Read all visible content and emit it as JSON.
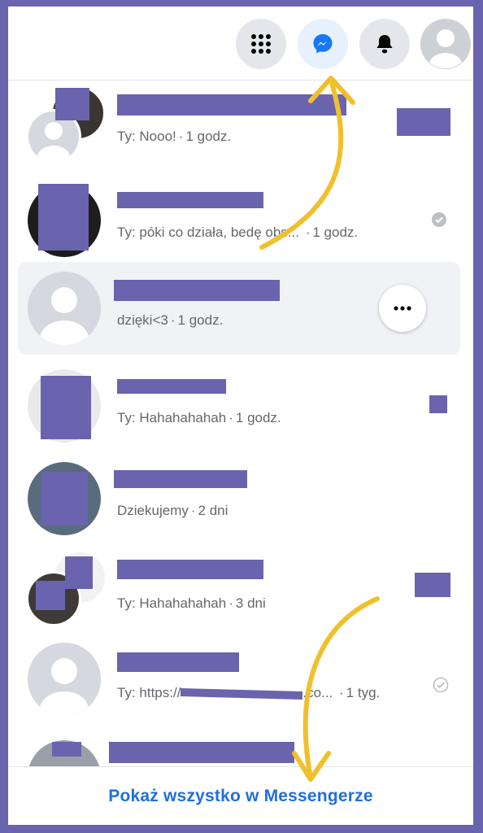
{
  "header": {
    "icons": [
      "menu-grid-icon",
      "messenger-icon",
      "bell-icon",
      "profile-icon"
    ],
    "active": "messenger-icon"
  },
  "conversations": [
    {
      "subtitle": "Ty: Nooo!",
      "time": "1 godz."
    },
    {
      "subtitle": "Ty: póki co działa, bedę obs...",
      "time": "1 godz.",
      "status": "read"
    },
    {
      "subtitle": "dzięki<3",
      "time": "1 godz.",
      "hovered": true
    },
    {
      "subtitle": "Ty: Hahahahahah",
      "time": "1 godz."
    },
    {
      "subtitle": "Dziekujemy",
      "time": "2 dni"
    },
    {
      "subtitle": "Ty: Hahahahahah",
      "time": "3 dni"
    },
    {
      "subtitle": "Ty: https://",
      "subtitle_end": ".co...",
      "time": "1 tyg.",
      "status": "sent"
    },
    {
      "subtitle": "",
      "time": ""
    }
  ],
  "footer": {
    "link": "Pokaż wszystko w Messengerze"
  },
  "colors": {
    "accent": "#216fdb",
    "censor": "#6a63ad",
    "annotation_arrow": "#f0c02c",
    "background_frame": "#6a63ad"
  }
}
